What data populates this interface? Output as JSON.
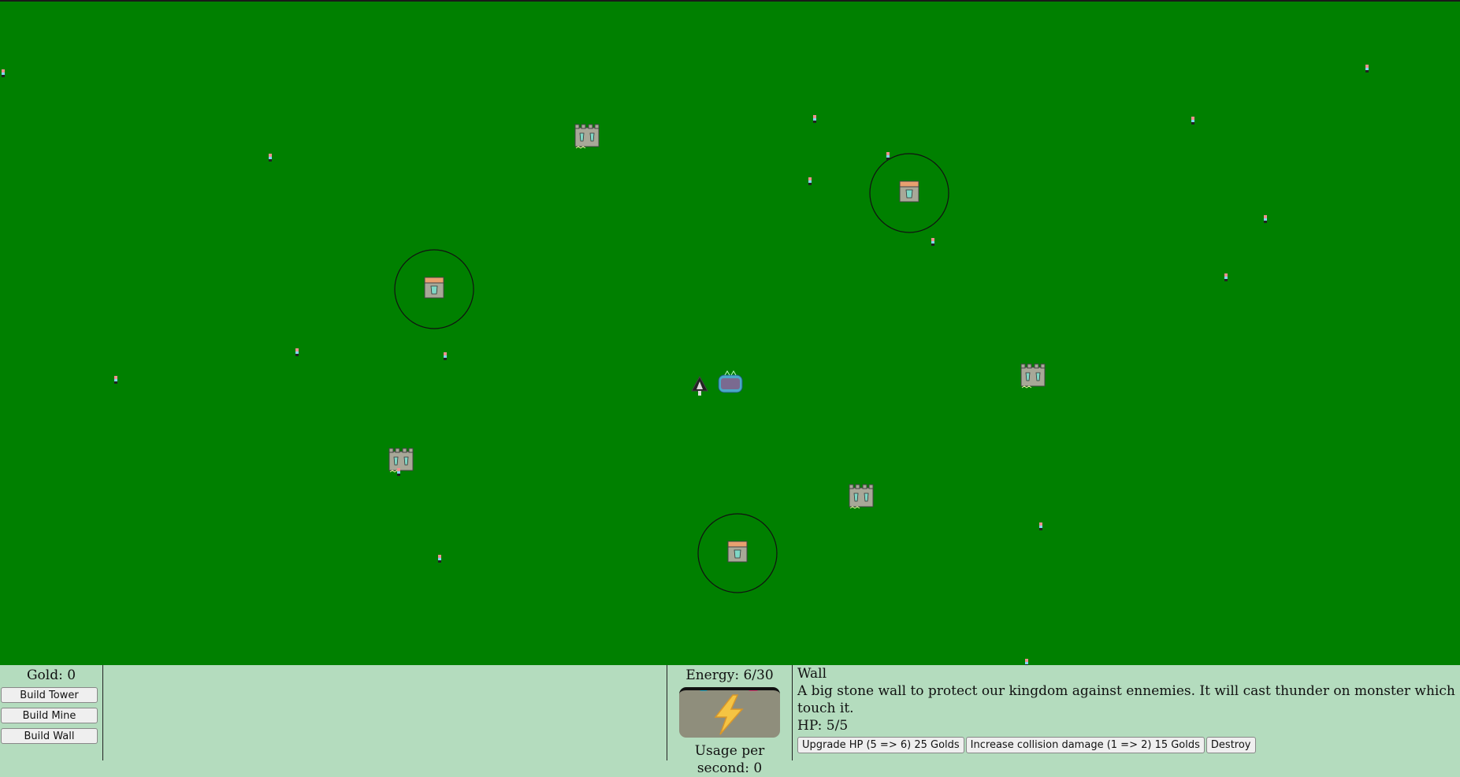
{
  "hud": {
    "gold": "Gold: 0",
    "build_tower": "Build Tower",
    "build_mine": "Build Mine",
    "build_wall": "Build Wall",
    "energy": "Energy: 6/30",
    "usage": "Usage per second: 0",
    "energy_icon": "lightning-bolt-icon"
  },
  "info": {
    "title": "Wall",
    "description": "A big stone wall to protect our kingdom against ennemies. It will cast thunder on monster which touch it.",
    "hp": "HP: 5/5",
    "upgrade_hp": "Upgrade HP (5 => 6) 25 Golds",
    "increase_damage": "Increase collision damage (1 => 2) 15 Golds",
    "destroy": "Destroy"
  },
  "colors": {
    "field": "#008000",
    "hud_bg": "#b4dcbe",
    "wall_stone": "#a8a898",
    "tower_roof": "#e8a070",
    "crystal": "#7fd7c6",
    "lightning": "#f5c443"
  }
}
